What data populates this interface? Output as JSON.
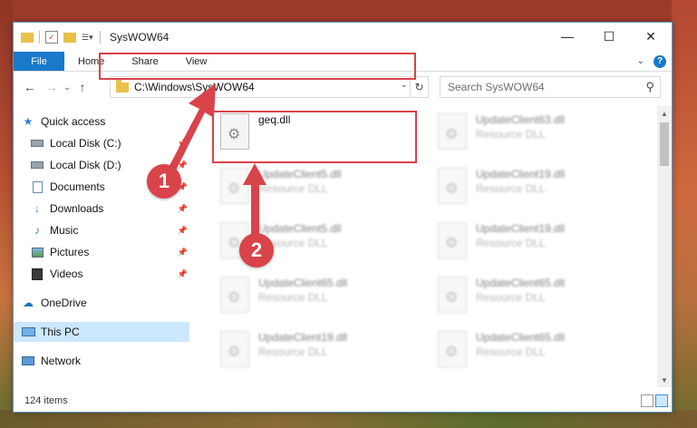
{
  "window": {
    "title": "SysWOW64"
  },
  "title_buttons": {
    "minimize": "—",
    "maximize": "☐",
    "close": "✕"
  },
  "ribbon": {
    "tabs": [
      "File",
      "Home",
      "Share",
      "View"
    ]
  },
  "address_bar": {
    "path": "C:\\Windows\\SysWOW64"
  },
  "search": {
    "placeholder": "Search SysWOW64"
  },
  "sidebar": {
    "items": [
      {
        "label": "Quick access",
        "icon": "star-icon"
      },
      {
        "label": "Local Disk (C:)",
        "icon": "drive-icon"
      },
      {
        "label": "Local Disk (D:)",
        "icon": "drive-icon"
      },
      {
        "label": "Documents",
        "icon": "documents-icon"
      },
      {
        "label": "Downloads",
        "icon": "download-icon"
      },
      {
        "label": "Music",
        "icon": "music-icon"
      },
      {
        "label": "Pictures",
        "icon": "pictures-icon"
      },
      {
        "label": "Videos",
        "icon": "videos-icon"
      },
      {
        "label": "OneDrive",
        "icon": "cloud-icon"
      },
      {
        "label": "This PC",
        "icon": "computer-icon"
      },
      {
        "label": "Network",
        "icon": "network-icon"
      }
    ]
  },
  "files": [
    {
      "name": "geq.dll",
      "type": ""
    },
    {
      "name": "UpdateClient63.dll",
      "type": "Resource DLL"
    },
    {
      "name": "UpdateClient5.dll",
      "type": "Resource DLL"
    },
    {
      "name": "UpdateClient19.dll",
      "type": "Resource DLL"
    },
    {
      "name": "UpdateClient5.dll",
      "type": "Resource DLL"
    },
    {
      "name": "UpdateClient19.dll",
      "type": "Resource DLL"
    },
    {
      "name": "UpdateClient65.dll",
      "type": "Resource DLL"
    },
    {
      "name": "UpdateClient65.dll",
      "type": "Resource DLL"
    },
    {
      "name": "UpdateClient19.dll",
      "type": "Resource DLL"
    },
    {
      "name": "UpdateClient65.dll",
      "type": "Resource DLL"
    }
  ],
  "status": {
    "item_count": "124 items"
  },
  "callouts": [
    "1",
    "2"
  ],
  "colors": {
    "accent": "#1979ca",
    "highlight": "#d9434a",
    "selected": "#cce8ff"
  }
}
